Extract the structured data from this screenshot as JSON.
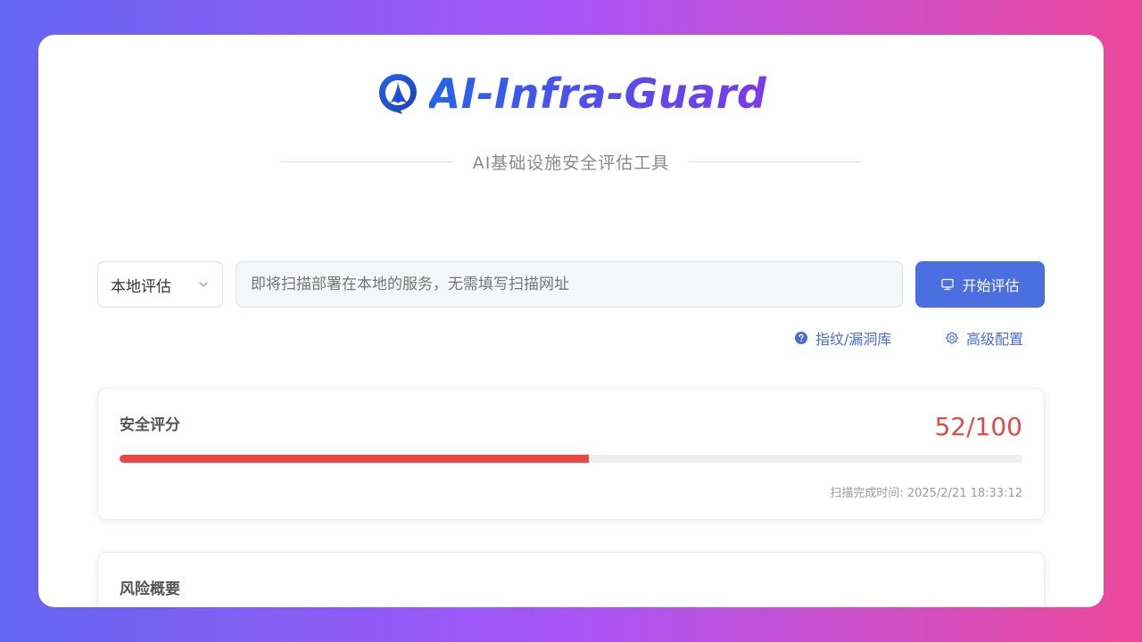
{
  "brand": {
    "title": "AI-Infra-Guard",
    "subtitle": "AI基础设施安全评估工具",
    "logo_icon": "shield-q-logo-icon"
  },
  "scan_form": {
    "mode_value": "本地评估",
    "target_placeholder": "即将扫描部署在本地的服务，无需填写扫描网址",
    "start_label": "开始评估",
    "start_icon": "monitor-icon"
  },
  "links": {
    "fingerprint_db": "指纹/漏洞库",
    "advanced_config": "高级配置"
  },
  "score": {
    "title": "安全评分",
    "value_text": "52/100",
    "percent": 52,
    "scan_time": "扫描完成时间: 2025/2/21 18:33:12"
  },
  "risk": {
    "title": "风险概要"
  },
  "colors": {
    "accent": "#4b6fe0",
    "danger": "#ef4444",
    "gradient_start": "#6366f1",
    "gradient_mid": "#a855f7",
    "gradient_end": "#ec4899"
  }
}
